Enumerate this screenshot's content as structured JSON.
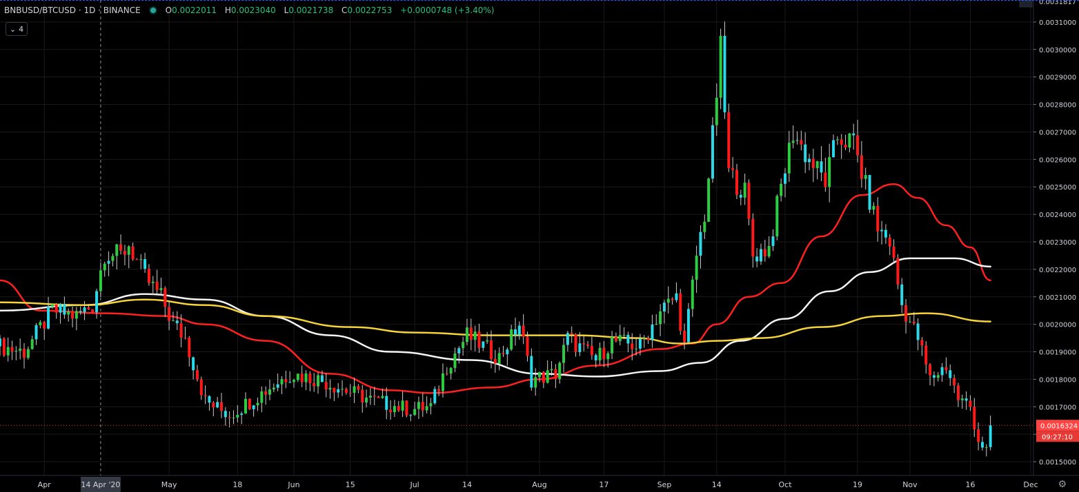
{
  "header": {
    "symbol": "BNBUSD/BTCUSD · 1D · BINANCE",
    "o_label": "O",
    "o": "0.0022011",
    "h_label": "H",
    "h": "0.0023040",
    "l_label": "L",
    "l": "0.0021738",
    "c_label": "C",
    "c": "0.0022753",
    "change": "+0.0000748 (+3.40%)"
  },
  "collapse_count": "4",
  "icons": {
    "collapse": "chevron-down-icon",
    "settings": "gear-icon",
    "status": "live-dot-icon"
  },
  "colors": {
    "up": "#2ecc40",
    "down": "#ff1a1a",
    "up_wick": "#e0e0e0",
    "ma_red": "#ff2020",
    "ma_white": "#f5f5f5",
    "ma_yellow": "#f5d33a",
    "crosshair": "#9598a1",
    "grid": "#1a1a1a",
    "current_price": "#ff4444"
  },
  "chart_data": {
    "type": "candlestick",
    "ylim": [
      0.00145,
      0.00318
    ],
    "y_ticks": [
      "0.0015000",
      "0.0016000",
      "0.0017000",
      "0.0018000",
      "0.0019000",
      "0.0020000",
      "0.0021000",
      "0.0022000",
      "0.0023000",
      "0.0024000",
      "0.0025000",
      "0.0026000",
      "0.0027000",
      "0.0028000",
      "0.0029000",
      "0.0030000",
      "0.0031000"
    ],
    "top_tick": "0.0031817",
    "x_ticks": [
      {
        "label": "Apr",
        "date": "2020-03-31"
      },
      {
        "label": "May",
        "date": "2020-05-01"
      },
      {
        "label": "18",
        "date": "2020-05-18"
      },
      {
        "label": "Jun",
        "date": "2020-06-01"
      },
      {
        "label": "15",
        "date": "2020-06-15"
      },
      {
        "label": "Jul",
        "date": "2020-07-01"
      },
      {
        "label": "14",
        "date": "2020-07-14"
      },
      {
        "label": "Aug",
        "date": "2020-08-01"
      },
      {
        "label": "17",
        "date": "2020-08-17"
      },
      {
        "label": "Sep",
        "date": "2020-09-01"
      },
      {
        "label": "14",
        "date": "2020-09-14"
      },
      {
        "label": "Oct",
        "date": "2020-10-01"
      },
      {
        "label": "19",
        "date": "2020-10-19"
      },
      {
        "label": "Nov",
        "date": "2020-11-01"
      },
      {
        "label": "16",
        "date": "2020-11-16"
      },
      {
        "label": "Dec",
        "date": "2020-12-01"
      }
    ],
    "x_range": [
      "2020-03-20",
      "2020-12-01"
    ],
    "crosshair_date_label": "14 Apr '20",
    "crosshair_date": "2020-04-14",
    "current_price": "0.0016324",
    "current_price_value": 0.0016324,
    "countdown": "09:27:10",
    "close_path": [
      {
        "date": "2020-03-20",
        "v": 0.00192
      },
      {
        "date": "2020-03-26",
        "v": 0.0019
      },
      {
        "date": "2020-04-02",
        "v": 0.00205
      },
      {
        "date": "2020-04-08",
        "v": 0.00203
      },
      {
        "date": "2020-04-12",
        "v": 0.00207
      },
      {
        "date": "2020-04-15",
        "v": 0.00226
      },
      {
        "date": "2020-04-19",
        "v": 0.00225
      },
      {
        "date": "2020-04-21",
        "v": 0.00229
      },
      {
        "date": "2020-04-25",
        "v": 0.00217
      },
      {
        "date": "2020-04-29",
        "v": 0.0021
      },
      {
        "date": "2020-05-02",
        "v": 0.002
      },
      {
        "date": "2020-05-05",
        "v": 0.00195
      },
      {
        "date": "2020-05-10",
        "v": 0.00172
      },
      {
        "date": "2020-05-16",
        "v": 0.00167
      },
      {
        "date": "2020-05-23",
        "v": 0.00174
      },
      {
        "date": "2020-05-31",
        "v": 0.00182
      },
      {
        "date": "2020-06-07",
        "v": 0.0018
      },
      {
        "date": "2020-06-14",
        "v": 0.00176
      },
      {
        "date": "2020-06-21",
        "v": 0.00172
      },
      {
        "date": "2020-06-30",
        "v": 0.00169
      },
      {
        "date": "2020-07-05",
        "v": 0.0017
      },
      {
        "date": "2020-07-09",
        "v": 0.00185
      },
      {
        "date": "2020-07-14",
        "v": 0.00196
      },
      {
        "date": "2020-07-22",
        "v": 0.00188
      },
      {
        "date": "2020-07-27",
        "v": 0.002
      },
      {
        "date": "2020-07-30",
        "v": 0.0018
      },
      {
        "date": "2020-08-05",
        "v": 0.00182
      },
      {
        "date": "2020-08-08",
        "v": 0.00195
      },
      {
        "date": "2020-08-15",
        "v": 0.00187
      },
      {
        "date": "2020-08-19",
        "v": 0.00194
      },
      {
        "date": "2020-08-26",
        "v": 0.00192
      },
      {
        "date": "2020-08-31",
        "v": 0.00205
      },
      {
        "date": "2020-09-04",
        "v": 0.0021
      },
      {
        "date": "2020-09-06",
        "v": 0.00192
      },
      {
        "date": "2020-09-09",
        "v": 0.00225
      },
      {
        "date": "2020-09-11",
        "v": 0.0024
      },
      {
        "date": "2020-09-13",
        "v": 0.00268
      },
      {
        "date": "2020-09-15",
        "v": 0.003
      },
      {
        "date": "2020-09-17",
        "v": 0.00255
      },
      {
        "date": "2020-09-21",
        "v": 0.00248
      },
      {
        "date": "2020-09-23",
        "v": 0.00225
      },
      {
        "date": "2020-09-27",
        "v": 0.00228
      },
      {
        "date": "2020-09-30",
        "v": 0.0025
      },
      {
        "date": "2020-10-03",
        "v": 0.0027
      },
      {
        "date": "2020-10-06",
        "v": 0.00262
      },
      {
        "date": "2020-10-11",
        "v": 0.00252
      },
      {
        "date": "2020-10-14",
        "v": 0.00268
      },
      {
        "date": "2020-10-18",
        "v": 0.00266
      },
      {
        "date": "2020-10-21",
        "v": 0.0025
      },
      {
        "date": "2020-10-24",
        "v": 0.00235
      },
      {
        "date": "2020-10-27",
        "v": 0.0023
      },
      {
        "date": "2020-10-30",
        "v": 0.00207
      },
      {
        "date": "2020-11-03",
        "v": 0.00195
      },
      {
        "date": "2020-11-06",
        "v": 0.0018
      },
      {
        "date": "2020-11-10",
        "v": 0.00185
      },
      {
        "date": "2020-11-13",
        "v": 0.00173
      },
      {
        "date": "2020-11-16",
        "v": 0.0017
      },
      {
        "date": "2020-11-18",
        "v": 0.00158
      },
      {
        "date": "2020-11-20",
        "v": 0.00154
      },
      {
        "date": "2020-11-21",
        "v": 0.00163
      }
    ],
    "moving_averages": [
      {
        "color_key": "ma_red",
        "points": [
          {
            "date": "2020-03-20",
            "v": 0.00216
          },
          {
            "date": "2020-03-30",
            "v": 0.00205
          },
          {
            "date": "2020-04-15",
            "v": 0.00204
          },
          {
            "date": "2020-04-30",
            "v": 0.00203
          },
          {
            "date": "2020-05-10",
            "v": 0.002
          },
          {
            "date": "2020-05-25",
            "v": 0.00194
          },
          {
            "date": "2020-06-10",
            "v": 0.00182
          },
          {
            "date": "2020-06-25",
            "v": 0.00176
          },
          {
            "date": "2020-07-05",
            "v": 0.00175
          },
          {
            "date": "2020-07-20",
            "v": 0.00177
          },
          {
            "date": "2020-08-01",
            "v": 0.0018
          },
          {
            "date": "2020-08-15",
            "v": 0.00185
          },
          {
            "date": "2020-08-31",
            "v": 0.00191
          },
          {
            "date": "2020-09-08",
            "v": 0.00193
          },
          {
            "date": "2020-09-14",
            "v": 0.002
          },
          {
            "date": "2020-09-22",
            "v": 0.0021
          },
          {
            "date": "2020-09-30",
            "v": 0.00215
          },
          {
            "date": "2020-10-10",
            "v": 0.00232
          },
          {
            "date": "2020-10-20",
            "v": 0.00247
          },
          {
            "date": "2020-10-28",
            "v": 0.00251
          },
          {
            "date": "2020-11-03",
            "v": 0.00246
          },
          {
            "date": "2020-11-10",
            "v": 0.00236
          },
          {
            "date": "2020-11-16",
            "v": 0.00228
          },
          {
            "date": "2020-11-21",
            "v": 0.00216
          }
        ]
      },
      {
        "color_key": "ma_white",
        "points": [
          {
            "date": "2020-03-20",
            "v": 0.00205
          },
          {
            "date": "2020-04-10",
            "v": 0.00207
          },
          {
            "date": "2020-04-25",
            "v": 0.00211
          },
          {
            "date": "2020-05-10",
            "v": 0.00209
          },
          {
            "date": "2020-05-25",
            "v": 0.00203
          },
          {
            "date": "2020-06-10",
            "v": 0.00196
          },
          {
            "date": "2020-06-25",
            "v": 0.0019
          },
          {
            "date": "2020-07-15",
            "v": 0.00187
          },
          {
            "date": "2020-08-01",
            "v": 0.00182
          },
          {
            "date": "2020-08-15",
            "v": 0.00181
          },
          {
            "date": "2020-08-31",
            "v": 0.00183
          },
          {
            "date": "2020-09-10",
            "v": 0.00186
          },
          {
            "date": "2020-09-20",
            "v": 0.00194
          },
          {
            "date": "2020-10-01",
            "v": 0.00202
          },
          {
            "date": "2020-10-12",
            "v": 0.00212
          },
          {
            "date": "2020-10-22",
            "v": 0.00219
          },
          {
            "date": "2020-11-01",
            "v": 0.00224
          },
          {
            "date": "2020-11-12",
            "v": 0.00224
          },
          {
            "date": "2020-11-21",
            "v": 0.00221
          }
        ]
      },
      {
        "color_key": "ma_yellow",
        "points": [
          {
            "date": "2020-03-20",
            "v": 0.00208
          },
          {
            "date": "2020-04-10",
            "v": 0.00207
          },
          {
            "date": "2020-04-25",
            "v": 0.00209
          },
          {
            "date": "2020-05-10",
            "v": 0.00207
          },
          {
            "date": "2020-05-25",
            "v": 0.00203
          },
          {
            "date": "2020-06-15",
            "v": 0.00199
          },
          {
            "date": "2020-07-01",
            "v": 0.00197
          },
          {
            "date": "2020-07-20",
            "v": 0.00196
          },
          {
            "date": "2020-08-10",
            "v": 0.00196
          },
          {
            "date": "2020-08-25",
            "v": 0.00195
          },
          {
            "date": "2020-09-05",
            "v": 0.00193
          },
          {
            "date": "2020-09-14",
            "v": 0.00194
          },
          {
            "date": "2020-09-25",
            "v": 0.00195
          },
          {
            "date": "2020-10-10",
            "v": 0.00199
          },
          {
            "date": "2020-10-25",
            "v": 0.00203
          },
          {
            "date": "2020-11-05",
            "v": 0.00204
          },
          {
            "date": "2020-11-21",
            "v": 0.00201
          }
        ]
      }
    ]
  }
}
